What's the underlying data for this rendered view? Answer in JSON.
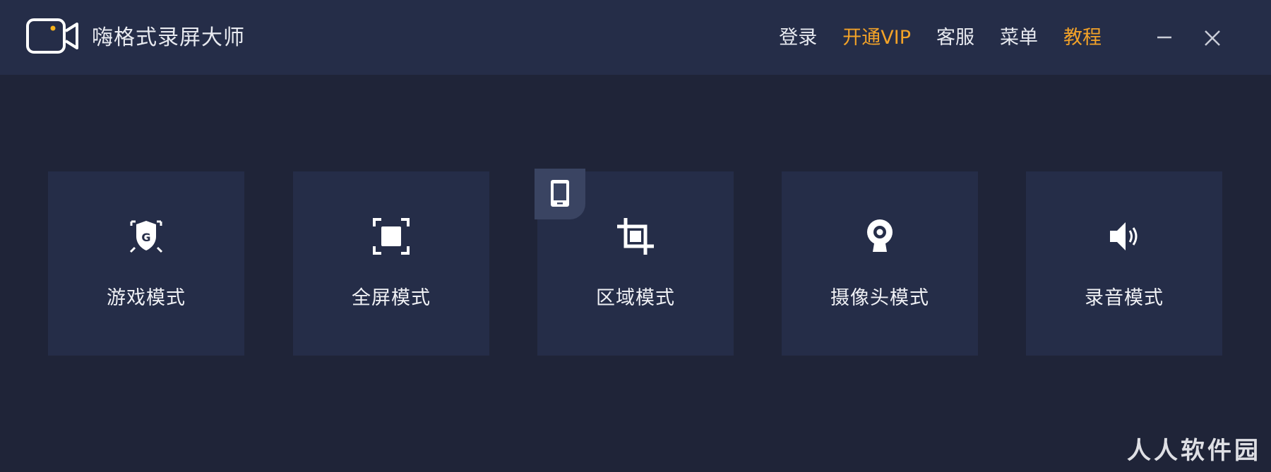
{
  "app": {
    "title": "嗨格式录屏大师"
  },
  "nav": {
    "items": [
      {
        "label": "登录",
        "accent": false
      },
      {
        "label": "开通VIP",
        "accent": true
      },
      {
        "label": "客服",
        "accent": false
      },
      {
        "label": "菜单",
        "accent": false
      },
      {
        "label": "教程",
        "accent": true
      }
    ]
  },
  "window_controls": {
    "minimize_icon": "minimize-icon",
    "close_icon": "close-icon"
  },
  "modes": [
    {
      "label": "游戏模式",
      "icon": "game-shield-icon"
    },
    {
      "label": "全屏模式",
      "icon": "fullscreen-icon"
    },
    {
      "label": "区域模式",
      "icon": "crop-icon",
      "badge_icon": "tablet-icon"
    },
    {
      "label": "摄像头模式",
      "icon": "webcam-icon"
    },
    {
      "label": "录音模式",
      "icon": "speaker-icon"
    }
  ],
  "colors": {
    "background": "#1f2438",
    "titlebar": "#252d48",
    "card": "#252d48",
    "accent": "#f2a228",
    "logo_dot": "#f6b21b"
  },
  "watermark": "人人软件园"
}
